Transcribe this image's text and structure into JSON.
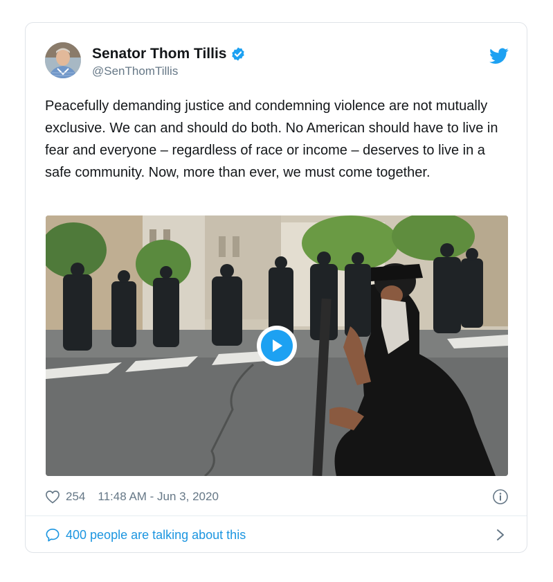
{
  "author": {
    "display_name": "Senator Thom Tillis",
    "handle": "@SenThomTillis",
    "verified": true
  },
  "tweet": {
    "text": "Peacefully demanding justice and condemning violence are not mutually exclusive. We can and should do both. No American should have to live in fear and everyone – regardless of race or income – deserves to live in a safe community. Now, more than ever, we must come together."
  },
  "media": {
    "type": "video",
    "icon": "play-icon"
  },
  "meta": {
    "like_count": "254",
    "timestamp": "11:48 AM - Jun 3, 2020"
  },
  "footer": {
    "conversation_label": "400 people are talking about this"
  },
  "colors": {
    "brand_blue": "#1da1f2",
    "link_blue": "#1b95e0",
    "text": "#14171a",
    "muted": "#657786"
  }
}
